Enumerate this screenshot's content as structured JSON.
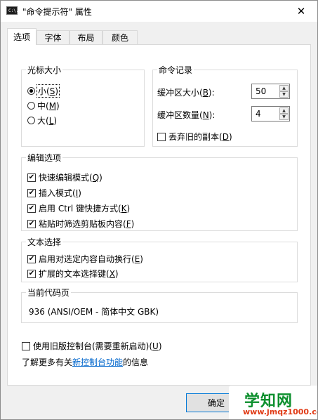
{
  "window": {
    "title": "\"命令提示符\" 属性",
    "app_icon_text": "C:\\.",
    "close_glyph": "✕"
  },
  "tabs": [
    {
      "label": "选项",
      "active": true
    },
    {
      "label": "字体",
      "active": false
    },
    {
      "label": "布局",
      "active": false
    },
    {
      "label": "颜色",
      "active": false
    }
  ],
  "cursor_size": {
    "legend": "光标大小",
    "options": [
      {
        "text": "小(",
        "key": "S",
        "end": ")",
        "selected": true
      },
      {
        "text": "中(",
        "key": "M",
        "end": ")",
        "selected": false
      },
      {
        "text": "大(",
        "key": "L",
        "end": ")",
        "selected": false
      }
    ]
  },
  "command_history": {
    "legend": "命令记录",
    "buffer_size_label": "缓冲区大小(",
    "buffer_size_key": "B",
    "buffer_size_end": "):",
    "buffer_size_value": "50",
    "buffer_count_label": "缓冲区数量(",
    "buffer_count_key": "N",
    "buffer_count_end": "):",
    "buffer_count_value": "4",
    "discard_label": "丢弃旧的副本(",
    "discard_key": "D",
    "discard_end": ")",
    "discard_checked": false
  },
  "edit_options": {
    "legend": "编辑选项",
    "items": [
      {
        "text": "快速编辑模式(",
        "key": "Q",
        "end": ")",
        "checked": true
      },
      {
        "text": "插入模式(",
        "key": "I",
        "end": ")",
        "checked": true
      },
      {
        "text": "启用 Ctrl 键快捷方式(",
        "key": "K",
        "end": ")",
        "checked": true
      },
      {
        "text": "粘贴时筛选剪贴板内容(",
        "key": "F",
        "end": ")",
        "checked": true
      }
    ]
  },
  "text_selection": {
    "legend": "文本选择",
    "items": [
      {
        "text": "启用对选定内容自动换行(",
        "key": "E",
        "end": ")",
        "checked": true
      },
      {
        "text": "扩展的文本选择键(",
        "key": "X",
        "end": ")",
        "checked": true
      }
    ]
  },
  "codepage": {
    "legend": "当前代码页",
    "value": "936   (ANSI/OEM - 简体中文 GBK)"
  },
  "legacy_console": {
    "text": "使用旧版控制台(需要重新启动)(",
    "key": "U",
    "end": ")",
    "checked": false
  },
  "info": {
    "prefix": "了解更多有关",
    "link": "新控制台功能",
    "suffix": "的信息"
  },
  "buttons": {
    "ok": "确定"
  },
  "watermark": {
    "big": "学知网",
    "small": "www.jmqz1000.com"
  },
  "check_glyph": "✔",
  "spin": {
    "up": "▲",
    "down": "▼"
  }
}
